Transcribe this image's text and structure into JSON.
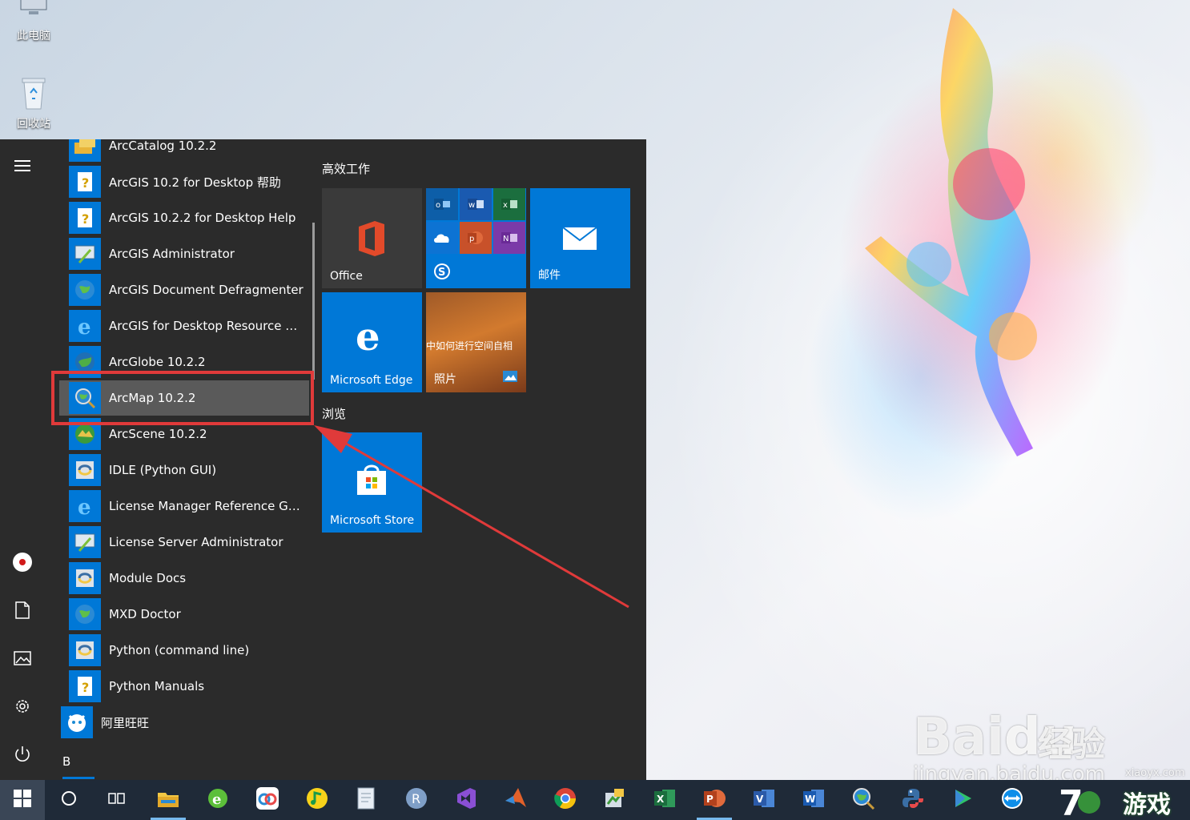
{
  "desktop": {
    "icons": [
      {
        "label": "此电脑",
        "icon": "computer-icon"
      },
      {
        "label": "回收站",
        "icon": "recycle-bin-icon"
      }
    ]
  },
  "start_menu": {
    "apps": [
      {
        "label": "ArcCatalog 10.2.2",
        "icon": "arccatalog-icon"
      },
      {
        "label": "ArcGIS 10.2 for Desktop 帮助",
        "icon": "help-icon"
      },
      {
        "label": "ArcGIS 10.2.2 for Desktop Help",
        "icon": "help-icon"
      },
      {
        "label": "ArcGIS Administrator",
        "icon": "admin-icon"
      },
      {
        "label": "ArcGIS Document Defragmenter",
        "icon": "globe-icon"
      },
      {
        "label": "ArcGIS for Desktop Resource Ce...",
        "icon": "ie-icon"
      },
      {
        "label": "ArcGlobe 10.2.2",
        "icon": "globe-icon"
      },
      {
        "label": "ArcMap 10.2.2",
        "icon": "arcmap-icon"
      },
      {
        "label": "ArcScene 10.2.2",
        "icon": "arcscene-icon"
      },
      {
        "label": "IDLE (Python GUI)",
        "icon": "python-icon"
      },
      {
        "label": "License Manager Reference Gui...",
        "icon": "ie-icon"
      },
      {
        "label": "License Server Administrator",
        "icon": "admin-icon"
      },
      {
        "label": "Module Docs",
        "icon": "python-icon"
      },
      {
        "label": "MXD Doctor",
        "icon": "globe-icon"
      },
      {
        "label": "Python (command line)",
        "icon": "python-icon"
      },
      {
        "label": "Python Manuals",
        "icon": "help-icon"
      },
      {
        "label": "阿里旺旺",
        "icon": "aliwangwang-icon"
      }
    ],
    "section_letter": "B",
    "groups": [
      {
        "title": "高效工作"
      },
      {
        "title": "浏览"
      }
    ],
    "tiles": {
      "office": "Office",
      "mail": "邮件",
      "edge": "Microsoft Edge",
      "photos": "照片",
      "photos_preview_text": "中如何进行空间自相",
      "store": "Microsoft Store"
    }
  },
  "taskbar": {
    "apps": [
      "file-explorer-icon",
      "ie-browser-icon",
      "baidu-netdisk-icon",
      "qq-music-icon",
      "notepad-icon",
      "r-icon",
      "visual-studio-icon",
      "matlab-icon",
      "chrome-icon",
      "arccatalog-icon",
      "excel-icon",
      "powerpoint-icon",
      "visio-icon",
      "word-icon",
      "arcmap-icon",
      "python-icon",
      "media-player-icon",
      "teamviewer-icon"
    ]
  },
  "watermark": {
    "baidu": "Bai",
    "baidu_du": "du",
    "jingyan": "经验",
    "url": "jingyan.baidu.com",
    "game_brand": "游戏",
    "site": "xiaoyx.com"
  },
  "colors": {
    "accent": "#0078d7",
    "menu_bg": "#2b2b2b",
    "taskbar_bg": "#1f2a38",
    "highlight_box": "#e03a3a"
  }
}
